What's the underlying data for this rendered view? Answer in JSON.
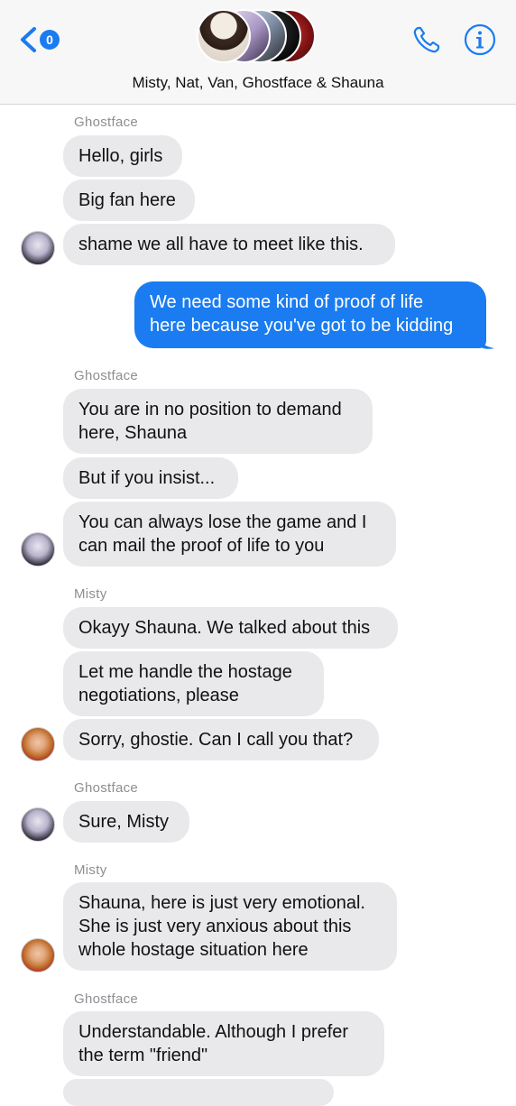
{
  "header": {
    "back_badge": "0",
    "group_title": "Misty, Nat, Van, Ghostface & Shauna",
    "back_icon": "chevron-left-icon",
    "call_icon": "phone-icon",
    "info_icon": "info-icon"
  },
  "colors": {
    "accent": "#1a7cf0",
    "incoming_bubble": "#e9e9eb",
    "sender_label": "#8e8e93"
  },
  "messages": {
    "g1_sender": "Ghostface",
    "g1_m1": "Hello, girls",
    "g1_m2": "Big fan here",
    "g1_m3": "shame we all have to meet like this.",
    "out1_l1": "We need some kind of proof of life",
    "out1_l2": "here because you've got to be kidding",
    "g2_sender": "Ghostface",
    "g2_m1_l1": "You are in no position to demand",
    "g2_m1_l2": "here, Shauna",
    "g2_m2": "But if you insist...",
    "g2_m3_l1": "You can always lose the game and I",
    "g2_m3_l2": "can mail the proof of life to you",
    "m1_sender": "Misty",
    "m1_m1": "Okayy Shauna. We talked about this",
    "m1_m2_l1": "Let me handle the hostage",
    "m1_m2_l2": "negotiations, please",
    "m1_m3": "Sorry, ghostie. Can I call you that?",
    "g3_sender": "Ghostface",
    "g3_m1": "Sure, Misty",
    "m2_sender": "Misty",
    "m2_m1_l1": "Shauna, here is just very emotional.",
    "m2_m1_l2": "She is just very anxious about this",
    "m2_m1_l3": "whole hostage situation here",
    "g4_sender": "Ghostface",
    "g4_m1_l1": "Understandable. Although I prefer",
    "g4_m1_l2": "the term \"friend\""
  }
}
